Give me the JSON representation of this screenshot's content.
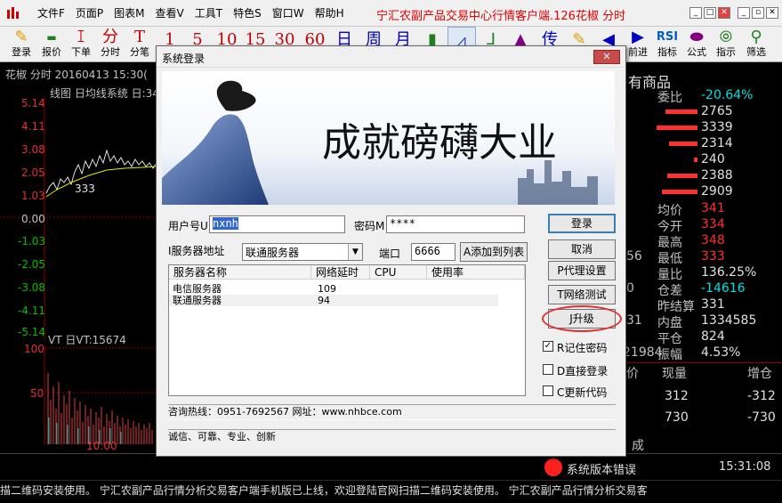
{
  "app": {
    "window_title": "宁汇农副产品交易中心行情客户端.126花椒 分时"
  },
  "menu": [
    "文件F",
    "页面P",
    "图表M",
    "查看V",
    "工具T",
    "特色S",
    "窗口W",
    "帮助H"
  ],
  "toolbar": {
    "items": [
      {
        "label": "登录",
        "icon": "login-icon"
      },
      {
        "label": "报价",
        "icon": "quote-icon"
      },
      {
        "label": "下单",
        "icon": "order-icon"
      },
      {
        "label": "分时",
        "icon": "fen-text"
      },
      {
        "label": "分笔",
        "icon": "T-text"
      }
    ],
    "periods": [
      "1",
      "5",
      "10",
      "15",
      "30",
      "60",
      "日",
      "周",
      "月"
    ],
    "right_items": [
      {
        "label": "前进",
        "icon": "forward-icon"
      },
      {
        "label": "指标",
        "icon": "rsi-icon"
      },
      {
        "label": "公式",
        "icon": "formula-icon"
      },
      {
        "label": "指示",
        "icon": "indicator-icon"
      },
      {
        "label": "筛选",
        "icon": "binoculars-icon"
      }
    ],
    "extra_glyph": "传"
  },
  "chart": {
    "header": "花椒 分时  20160413 15:30(",
    "legend": "线图 日均线系统 日:34",
    "y_ticks_up": [
      "5.14",
      "4.11",
      "3.08",
      "2.05",
      "1.03"
    ],
    "y_zero": "0.00",
    "y_ticks_down": [
      "-1.03",
      "-2.05",
      "-3.08",
      "-4.11",
      "-5.14"
    ],
    "price_label": "333",
    "vol_label": "VT 日VT:15674",
    "vol_ticks": [
      "100",
      "50"
    ],
    "time_label": "10:00"
  },
  "right_panel": {
    "title": "有商品",
    "weibi": {
      "key": "委比",
      "value": "-20.64%"
    },
    "order_book": [
      "2765",
      "3339",
      "2314",
      "240",
      "2388",
      "2909"
    ],
    "stats": [
      {
        "key": "均价",
        "value": "341"
      },
      {
        "key": "今开",
        "value": "334"
      },
      {
        "key": "最高",
        "value": "348"
      },
      {
        "key": "最低",
        "value": "333"
      },
      {
        "key": "量比",
        "value": "136.25%"
      },
      {
        "key": "仓差",
        "value": "-14616"
      },
      {
        "key": "昨结算",
        "value": "331"
      },
      {
        "key": "内盘",
        "value": "1334585"
      },
      {
        "key": "平仓",
        "value": "824"
      },
      {
        "key": "振幅",
        "value": "4.53%"
      }
    ],
    "side_fragments": [
      "56",
      "0",
      "31",
      "21984"
    ],
    "table_headers": [
      "价",
      "现量",
      "增仓"
    ],
    "table_rows": [
      {
        "qty": "312",
        "inc": "-312"
      },
      {
        "qty": "730",
        "inc": "-730"
      }
    ],
    "bottom_fragment": "成"
  },
  "dialog": {
    "title": "系统登录",
    "close_label": "✕",
    "banner_text": "成就磅礴大业",
    "username_label": "用户号U",
    "username_value": "nxnh",
    "password_label": "密码M",
    "password_value": "****",
    "server_label": "I服务器地址",
    "server_value": "联通服务器",
    "port_label": "端口",
    "port_value": "6666",
    "add_label": "A添加到列表",
    "buttons": {
      "login": "登录",
      "cancel": "取消",
      "proxy": "P代理设置",
      "nettest": "T网络测试",
      "upgrade": "J升级"
    },
    "table_headers": [
      "服务器名称",
      "网络延时",
      "CPU",
      "使用率"
    ],
    "servers": [
      {
        "name": "电信服务器",
        "latency": "109"
      },
      {
        "name": "联通服务器",
        "latency": "94"
      }
    ],
    "options": [
      {
        "label": "R记住密码",
        "checked": true
      },
      {
        "label": "D直接登录",
        "checked": false
      },
      {
        "label": "C更新代码",
        "checked": false
      }
    ],
    "hotline": "咨询热线：0951-7692567 网址：www.nhbce.com",
    "slogan": "诚信、可靠、专业、创新"
  },
  "status": {
    "message": "系统版本错误",
    "time": "15:31:08"
  },
  "ticker": "描二维码安装使用。    宁汇农副产品行情分析交易客户端手机版已上线，欢迎登陆官网扫描二维码安装使用。    宁汇农副产品行情分析交易客"
}
